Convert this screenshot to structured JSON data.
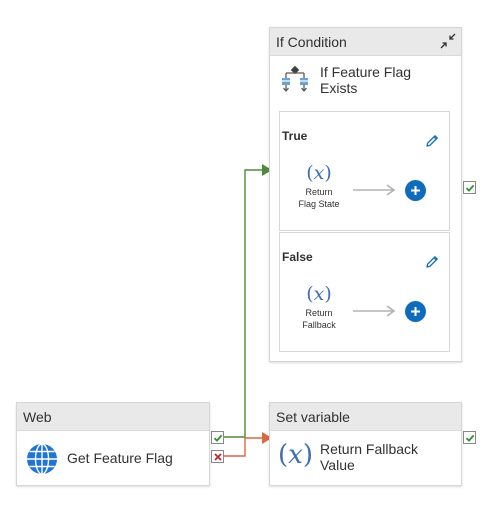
{
  "if_condition": {
    "type_label": "If Condition",
    "name_line1": "If Feature Flag",
    "name_line2": "Exists",
    "true_pane": {
      "title": "True",
      "activity_line1": "Return",
      "activity_line2": "Flag State"
    },
    "false_pane": {
      "title": "False",
      "activity_line1": "Return",
      "activity_line2": "Fallback"
    }
  },
  "web": {
    "type_label": "Web",
    "name": "Get Feature Flag"
  },
  "set_variable": {
    "type_label": "Set variable",
    "name_line1": "Return Fallback",
    "name_line2": "Value"
  },
  "colors": {
    "success": "#4f8a3b",
    "failure": "#d8683f",
    "accent": "#0f6cbd",
    "header_bg": "#e9e9e9"
  },
  "icons": {
    "collapse": "collapse-icon",
    "edit": "pencil-icon",
    "add": "plus-icon",
    "expression": "fx-icon",
    "web": "globe-icon",
    "if_condition": "branch-icon",
    "success": "check-icon",
    "failure": "x-icon"
  }
}
